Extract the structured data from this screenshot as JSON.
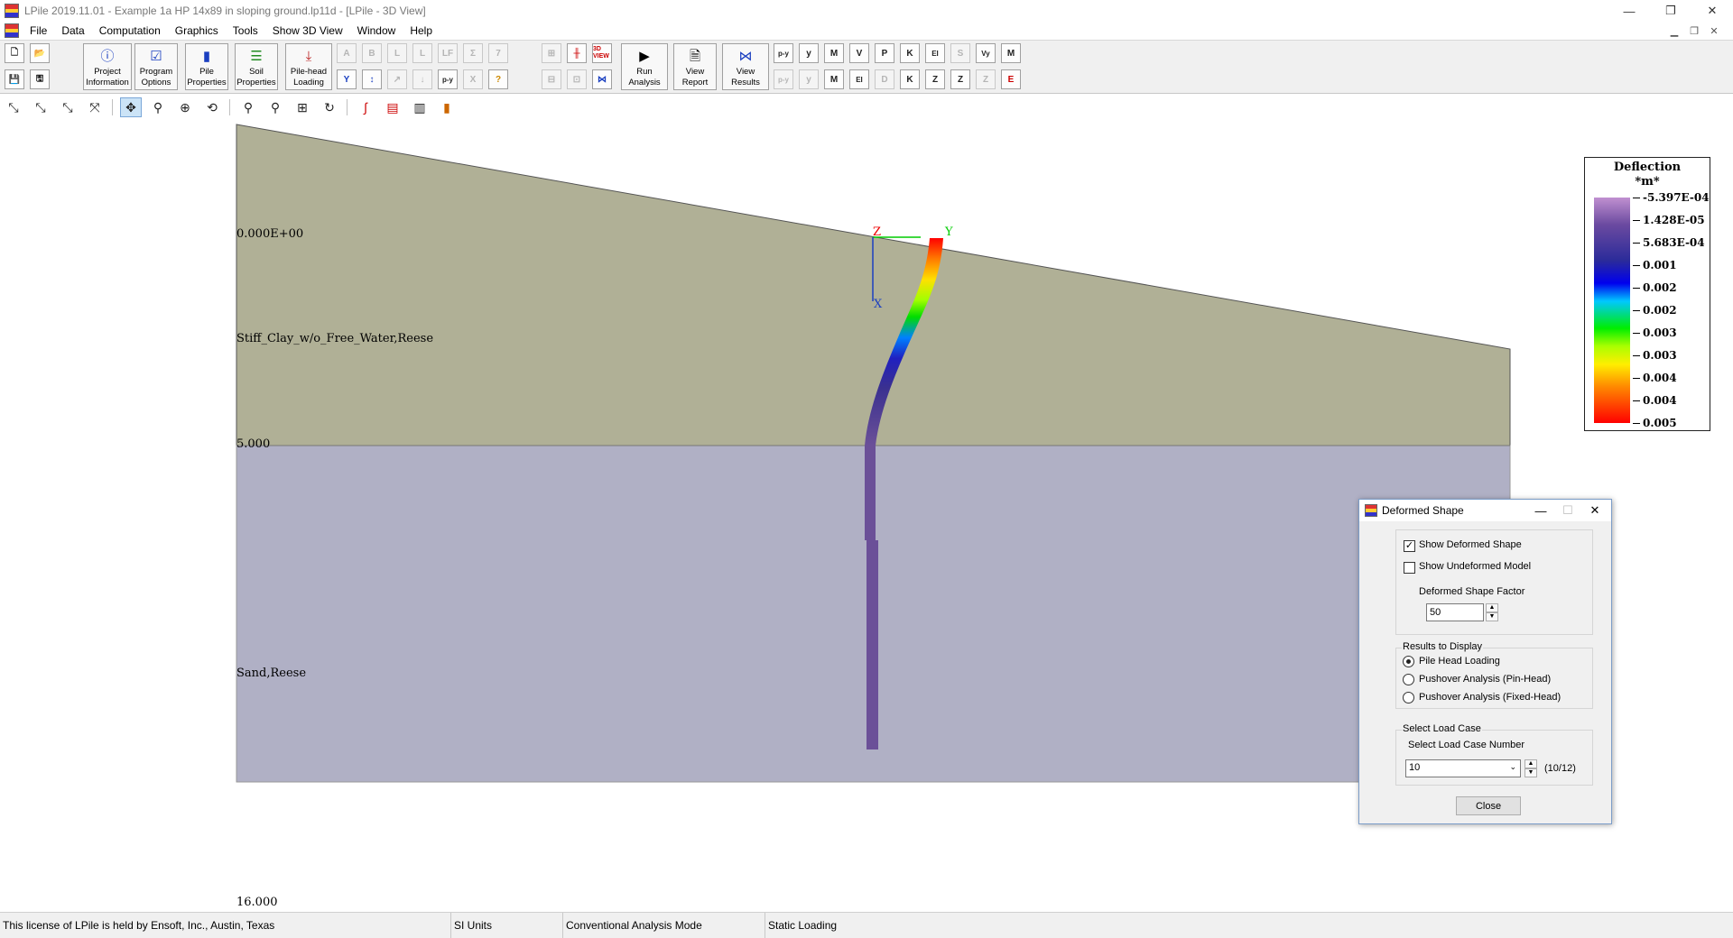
{
  "window": {
    "title": "LPile 2019.11.01 - Example 1a HP 14x89 in sloping ground.lp11d - [LPile - 3D View]"
  },
  "menu": [
    "File",
    "Data",
    "Computation",
    "Graphics",
    "Tools",
    "Show 3D View",
    "Window",
    "Help"
  ],
  "toolbar": {
    "big_buttons": [
      {
        "name": "project-information-button",
        "label": "Project\nInformation",
        "icon": "info-icon"
      },
      {
        "name": "program-options-button",
        "label": "Program\nOptions",
        "icon": "checkbox-icon"
      },
      {
        "name": "pile-properties-button",
        "label": "Pile\nProperties",
        "icon": "pile-icon"
      },
      {
        "name": "soil-properties-button",
        "label": "Soil\nProperties",
        "icon": "soil-layers-icon"
      },
      {
        "name": "pile-head-loading-button",
        "label": "Pile-head\nLoading",
        "icon": "load-arrow-icon"
      },
      {
        "name": "run-analysis-button",
        "label": "Run\nAnalysis",
        "icon": "play-icon"
      },
      {
        "name": "view-report-button",
        "label": "View\nReport",
        "icon": "report-icon"
      },
      {
        "name": "view-results-button",
        "label": "View\nResults",
        "icon": "results-icon"
      }
    ],
    "small_row1": [
      "p-y",
      "y",
      "M",
      "V",
      "P",
      "K",
      "EI",
      "S",
      "Vy",
      "M"
    ],
    "small_row2": [
      "p-y",
      "y",
      "M",
      "EI",
      "D",
      "K",
      "Z",
      "Z",
      "Z",
      "E"
    ],
    "mid_row1": [
      "A",
      "B",
      "L",
      "L",
      "LF",
      "Σ",
      "7"
    ],
    "mid_row2": [
      "Y",
      "↕",
      "↗",
      "↓",
      "p-y",
      "X",
      "?"
    ],
    "view3d_label": "3D VIEW"
  },
  "scene": {
    "labels": {
      "top_depth": "0.000E+00",
      "layer1": "Stiff_Clay_w/o_Free_Water,Reese",
      "mid_depth": "5.000",
      "layer2": "Sand,Reese",
      "bottom_depth": "16.000",
      "axis_z": "Z",
      "axis_y": "Y",
      "axis_x": "X"
    },
    "colors": {
      "layer1": "#b0b096",
      "layer2": "#b0b0c5",
      "pile_lower": "#6b5098"
    }
  },
  "legend": {
    "title": "Deflection",
    "unit": "*m*",
    "values": [
      "-5.397E-04",
      "1.428E-05",
      "5.683E-04",
      "0.001",
      "0.002",
      "0.002",
      "0.003",
      "0.003",
      "0.004",
      "0.004",
      "0.005"
    ]
  },
  "dialog": {
    "title": "Deformed Shape",
    "show_deformed_label": "Show Deformed Shape",
    "show_deformed_checked": true,
    "show_undeformed_label": "Show Undeformed Model",
    "show_undeformed_checked": false,
    "factor_label": "Deformed Shape Factor",
    "factor_value": "50",
    "results_group": "Results to Display",
    "results_options": [
      "Pile Head Loading",
      "Pushover Analysis (Pin-Head)",
      "Pushover Analysis (Fixed-Head)"
    ],
    "results_selected": 0,
    "loadcase_group": "Select Load Case",
    "loadcase_label": "Select Load Case Number",
    "loadcase_value": "10",
    "loadcase_count": "(10/12)",
    "close_label": "Close"
  },
  "status": {
    "license": "This license of LPile is held by Ensoft, Inc., Austin, Texas",
    "units": "SI Units",
    "mode": "Conventional Analysis Mode",
    "loading": "Static Loading"
  }
}
